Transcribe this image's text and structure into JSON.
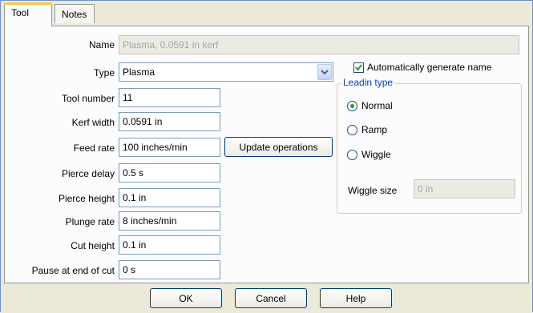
{
  "tabs": [
    {
      "label": "Tool",
      "active": true
    },
    {
      "label": "Notes",
      "active": false
    }
  ],
  "form": {
    "name_label": "Name",
    "name_value": "Plasma, 0.0591 in kerf",
    "type_label": "Type",
    "type_value": "Plasma",
    "tool_number_label": "Tool number",
    "tool_number_value": "11",
    "kerf_width_label": "Kerf width",
    "kerf_width_value": "0.0591 in",
    "feed_rate_label": "Feed rate",
    "feed_rate_value": "100 inches/min",
    "update_operations_label": "Update operations",
    "pierce_delay_label": "Pierce delay",
    "pierce_delay_value": "0.5 s",
    "pierce_height_label": "Pierce height",
    "pierce_height_value": "0.1 in",
    "plunge_rate_label": "Plunge rate",
    "plunge_rate_value": "8 inches/min",
    "cut_height_label": "Cut height",
    "cut_height_value": "0.1 in",
    "pause_label": "Pause at end of cut",
    "pause_value": "0 s"
  },
  "auto_name": {
    "label": "Automatically generate name",
    "checked": true
  },
  "leadin": {
    "legend": "Leadin type",
    "options": [
      {
        "label": "Normal",
        "selected": true
      },
      {
        "label": "Ramp",
        "selected": false
      },
      {
        "label": "Wiggle",
        "selected": false
      }
    ],
    "wiggle_size_label": "Wiggle size",
    "wiggle_size_value": "0 in"
  },
  "buttons": {
    "ok": "OK",
    "cancel": "Cancel",
    "help": "Help"
  },
  "colors": {
    "accent_tab": "#ffc83c",
    "legend_text": "#0046d5",
    "check_green": "#21a121"
  }
}
